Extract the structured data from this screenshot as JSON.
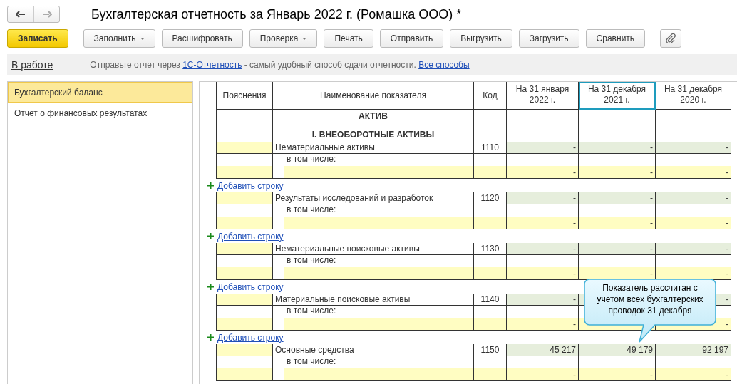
{
  "window": {
    "title": "Бухгалтерская отчетность за Январь 2022 г. (Ромашка ООО) *"
  },
  "toolbar": [
    {
      "label": "Записать",
      "kind": "primary"
    },
    {
      "label": "Заполнить",
      "kind": "dropdown"
    },
    {
      "label": "Расшифровать",
      "kind": "normal"
    },
    {
      "label": "Проверка",
      "kind": "dropdown"
    },
    {
      "label": "Печать",
      "kind": "normal"
    },
    {
      "label": "Отправить",
      "kind": "normal"
    },
    {
      "label": "Выгрузить",
      "kind": "normal"
    },
    {
      "label": "Загрузить",
      "kind": "normal"
    },
    {
      "label": "Сравнить",
      "kind": "normal"
    },
    {
      "kind": "attach"
    }
  ],
  "info_bar": {
    "status": "В работе",
    "text_before": "Отправьте отчет через",
    "link": "1С-Отчетность",
    "text_after": "- самый удобный способ сдачи отчетности.",
    "link_all": "Все способы"
  },
  "sidebar": {
    "items": [
      {
        "label": "Бухгалтерский баланс",
        "selected": true
      },
      {
        "label": "Отчет о финансовых результатах",
        "selected": false
      }
    ]
  },
  "report": {
    "columns": [
      {
        "label": "Пояснения",
        "selected": false
      },
      {
        "label": "Наименование показателя",
        "selected": false
      },
      {
        "label": "Код",
        "selected": false
      },
      {
        "label": "На 31 января 2022 г.",
        "selected": false
      },
      {
        "label": "На 31 декабря 2021 г.",
        "selected": true
      },
      {
        "label": "На 31 декабря 2020 г.",
        "selected": false
      }
    ],
    "headings": [
      "АКТИВ",
      "I. ВНЕОБОРОТНЫЕ АКТИВЫ"
    ],
    "rows": [
      {
        "name": "Нематериальные активы",
        "code": "1110",
        "value_1": "-",
        "value_2": "-",
        "value_3": "-",
        "sub_label": "в том числе:",
        "sub_value_1": "-",
        "sub_value_2": "-",
        "sub_value_3": "-",
        "add_link": "Добавить строку"
      },
      {
        "name": "Результаты исследований и разработок",
        "code": "1120",
        "value_1": "-",
        "value_2": "-",
        "value_3": "-",
        "sub_label": "в том числе:",
        "sub_value_1": "-",
        "sub_value_2": "-",
        "sub_value_3": "-",
        "add_link": "Добавить строку"
      },
      {
        "name": "Нематериальные поисковые активы",
        "code": "1130",
        "value_1": "-",
        "value_2": "-",
        "value_3": "-",
        "sub_label": "в том числе:",
        "sub_value_1": "-",
        "sub_value_2": "-",
        "sub_value_3": "-",
        "add_link": "Добавить строку"
      },
      {
        "name": "Материальные поисковые активы",
        "code": "1140",
        "value_1": "-",
        "value_3": "-",
        "sub_label": "в том числе:",
        "sub_value_1": "-",
        "sub_value_3": "-",
        "add_link": "Добавить строку"
      },
      {
        "name": "Основные средства",
        "code": "1150",
        "value_1": "45 217",
        "value_2": "49 179",
        "value_3": "92 197",
        "sub_label": "в том числе:",
        "sub_value_1": "-",
        "sub_value_2": "-",
        "sub_value_3": "-"
      }
    ],
    "tooltip": "Показатель рассчитан с учетом всех бухгалтерских проводок 31 декабря"
  }
}
